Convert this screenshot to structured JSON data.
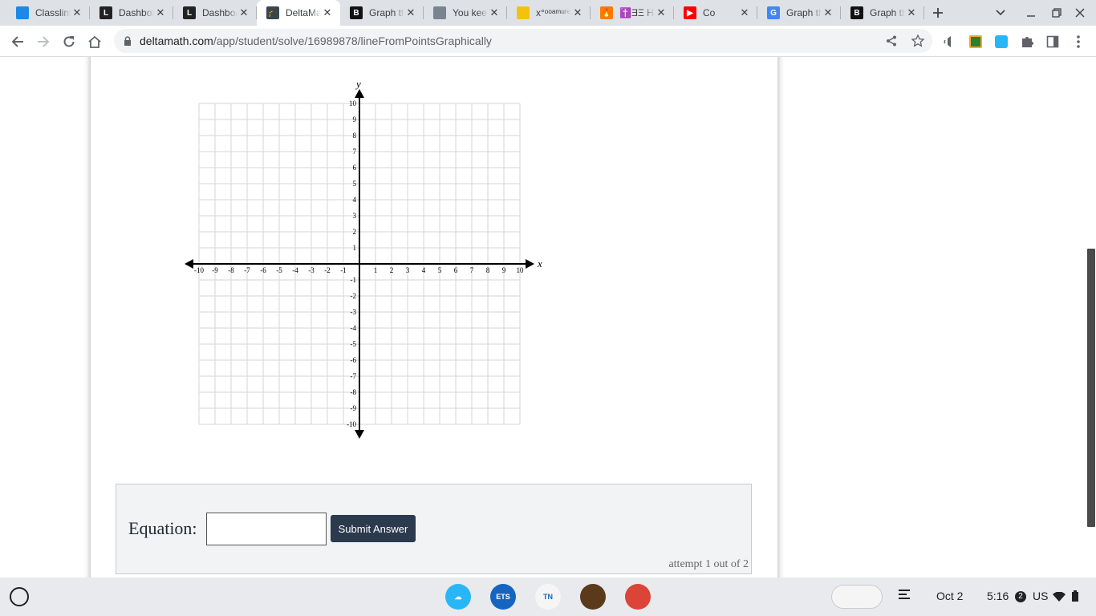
{
  "browser": {
    "tabs": [
      {
        "title": "Classlink",
        "favicon": "classlink-icon",
        "color": "#1e88e5",
        "glyph": "",
        "active": false
      },
      {
        "title": "Dashboard",
        "favicon": "l-logo-icon",
        "color": "#222222",
        "glyph": "L",
        "active": false
      },
      {
        "title": "Dashboard",
        "favicon": "l-logo-icon",
        "color": "#222222",
        "glyph": "L",
        "active": false
      },
      {
        "title": "DeltaMath",
        "favicon": "graduation-cap-icon",
        "color": "#37474f",
        "glyph": "🎓",
        "active": true
      },
      {
        "title": "Graph the line",
        "favicon": "brainly-icon",
        "color": "#111111",
        "glyph": "B",
        "active": false
      },
      {
        "title": "You keep",
        "favicon": "image-icon",
        "color": "#7a8490",
        "glyph": "",
        "active": false
      },
      {
        "title": "x°ᵒᵒᵃᵐᵘʳᵉ",
        "favicon": "yellow-dot-icon",
        "color": "#f4c20d",
        "glyph": "",
        "active": false
      },
      {
        "title": "✝️ƎΞ H",
        "favicon": "fire-icon",
        "color": "#ff7a00",
        "glyph": "🔥",
        "active": false
      },
      {
        "title": "Co",
        "favicon": "youtube-icon",
        "color": "#ff0000",
        "glyph": "▶",
        "active": false
      },
      {
        "title": "Graph the line",
        "favicon": "google-icon",
        "color": "#4285f4",
        "glyph": "G",
        "active": false
      },
      {
        "title": "Graph the line",
        "favicon": "brainly-icon",
        "color": "#111111",
        "glyph": "B",
        "active": false
      }
    ],
    "url_host": "deltamath.com",
    "url_path": "/app/student/solve/16989878/lineFromPointsGraphically"
  },
  "graph": {
    "x_axis_label": "x",
    "y_axis_label": "y",
    "x_min": -10,
    "x_max": 10,
    "y_min": -10,
    "y_max": 10,
    "x_ticks": [
      "-10",
      "-9",
      "-8",
      "-7",
      "-6",
      "-5",
      "-4",
      "-3",
      "-2",
      "-1",
      "1",
      "2",
      "3",
      "4",
      "5",
      "6",
      "7",
      "8",
      "9",
      "10"
    ],
    "y_ticks": [
      "10",
      "9",
      "8",
      "7",
      "6",
      "5",
      "4",
      "3",
      "2",
      "1",
      "-1",
      "-2",
      "-3",
      "-4",
      "-5",
      "-6",
      "-7",
      "-8",
      "-9",
      "-10"
    ],
    "grid": true
  },
  "answer": {
    "label": "Equation:",
    "input_value": "",
    "submit_label": "Submit Answer",
    "attempt_text": "attempt 1 out of 2"
  },
  "shelf": {
    "apps": [
      {
        "name": "classlink-app-icon",
        "color": "#29b6f6",
        "glyph": "☁"
      },
      {
        "name": "ets-app-icon",
        "color": "#1565c0",
        "glyph": "ETS"
      },
      {
        "name": "pearson-testnav-app-icon",
        "color": "#f5f5f5",
        "glyph": "TN"
      },
      {
        "name": "striped-app-icon",
        "color": "#5a3a1a",
        "glyph": ""
      },
      {
        "name": "chrome-app-icon",
        "color": "#db4437",
        "glyph": ""
      }
    ],
    "date": "Oct 2",
    "time": "5:16",
    "notification_count": "2",
    "locale": "US"
  }
}
